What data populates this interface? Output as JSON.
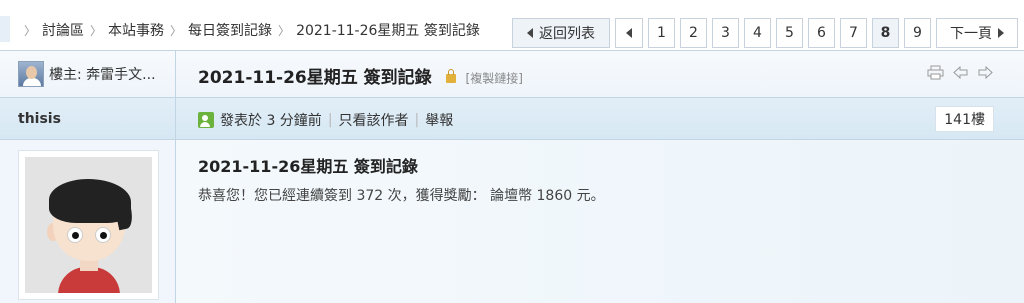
{
  "breadcrumb": {
    "items": [
      "討論區",
      "本站事務",
      "每日簽到記錄",
      "2021-11-26星期五 簽到記錄"
    ]
  },
  "pager": {
    "back_label": "返回列表",
    "pages": [
      "1",
      "2",
      "3",
      "4",
      "5",
      "6",
      "7",
      "8",
      "9"
    ],
    "current": "8",
    "next_label": "下一頁"
  },
  "thread": {
    "op_label": "樓主: 奔雷手文...",
    "title": "2021-11-26星期五 簽到記錄",
    "copy_link": "[複製鏈接]"
  },
  "post": {
    "author": "thisis",
    "posted": "發表於 3 分鐘前",
    "only_author": "只看該作者",
    "report": "舉報",
    "floor": "141樓",
    "title": "2021-11-26星期五 簽到記錄",
    "body": "恭喜您！您已經連續簽到 372 次，獲得獎勵： 論壇幣 1860 元。"
  },
  "colors": {
    "border": "#c2d5e3",
    "header_bg": "#d6e8f4",
    "online_green": "#6cb33e"
  },
  "icons": [
    "print-icon",
    "prev-thread-icon",
    "next-thread-icon",
    "lock-icon",
    "online-user-icon"
  ]
}
